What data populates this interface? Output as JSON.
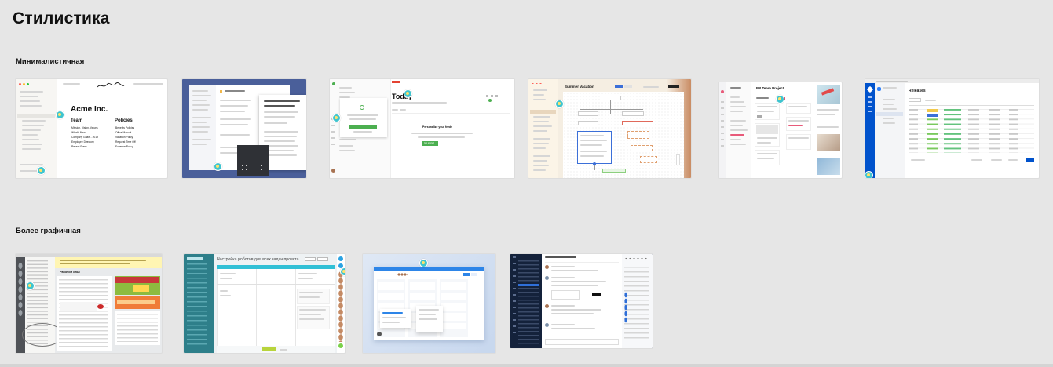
{
  "page": {
    "title": "Стилистика"
  },
  "sections": [
    {
      "title": "Минималистичная"
    },
    {
      "title": "Более графичная"
    }
  ],
  "thumbnails": {
    "notion": {
      "heading": "Acme Inc.",
      "team_label": "Team",
      "policies_label": "Policies",
      "team_items": [
        "Mission, Vision, Values",
        "What's New",
        "Company Goals - 2019",
        "Employee Directory",
        "Recent Press"
      ],
      "policy_items": [
        "Benefits Policies",
        "Office Manual",
        "Vacation Policy",
        "Request Time Off",
        "Expense Policy"
      ]
    },
    "todoist_today": {
      "title": "Today",
      "empty_title": "Personalize your feeds",
      "button": "Get started"
    },
    "vacation": {
      "title": "Summer Vacation"
    },
    "project": {
      "title": "PR Team Project"
    },
    "releases": {
      "title": "Releases"
    },
    "bitrix": {
      "title": "Рабочий стол"
    },
    "robots": {
      "title": "Настройка роботов для всех задач проекта"
    }
  },
  "colors": {
    "background": "#e6e6e6",
    "badge": "#3fc4cf",
    "todoist_accent": "#e44332",
    "blueprint": "#4a5f9a",
    "teal_panel": "#2e7f8a",
    "dark_chat": "#14223b"
  }
}
